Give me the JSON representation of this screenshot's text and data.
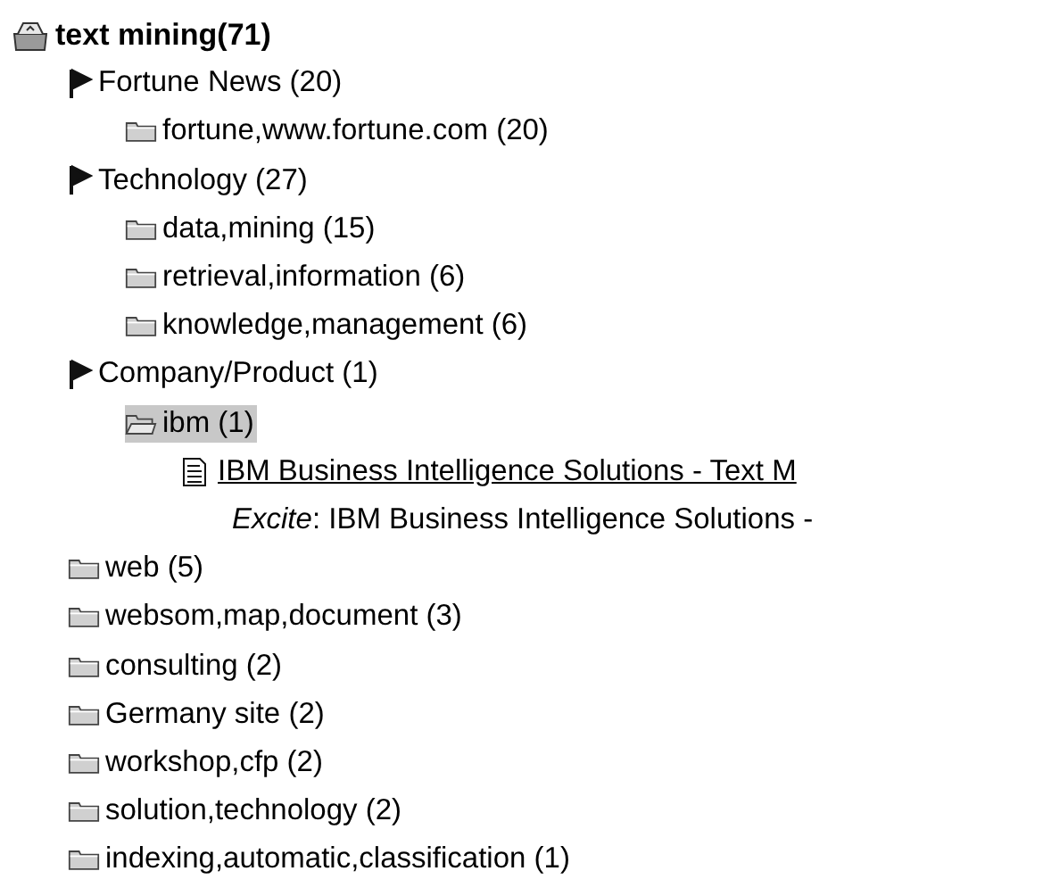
{
  "tree": {
    "kind": "root",
    "label": "text mining(71)",
    "children": [
      {
        "kind": "category",
        "label": "Fortune News (20)",
        "children": [
          {
            "kind": "folder",
            "label": "fortune,www.fortune.com (20)",
            "selected": false,
            "expanded": false
          }
        ]
      },
      {
        "kind": "category",
        "label": "Technology (27)",
        "children": [
          {
            "kind": "folder",
            "label": "data,mining (15)",
            "selected": false,
            "expanded": false
          },
          {
            "kind": "folder",
            "label": "retrieval,information (6)",
            "selected": false,
            "expanded": false
          },
          {
            "kind": "folder",
            "label": "knowledge,management (6)",
            "selected": false,
            "expanded": false
          }
        ]
      },
      {
        "kind": "category",
        "label": "Company/Product (1)",
        "children": [
          {
            "kind": "folder",
            "label": "ibm (1)",
            "selected": true,
            "expanded": true,
            "children": [
              {
                "kind": "document",
                "label": "IBM Business Intelligence Solutions - Text M",
                "children": [
                  {
                    "kind": "snippet",
                    "label": "*Excite*: IBM Business Intelligence Solutions -"
                  }
                ]
              }
            ]
          }
        ]
      },
      {
        "kind": "folder",
        "label": "web (5)",
        "selected": false,
        "expanded": false
      },
      {
        "kind": "folder",
        "label": "websom,map,document (3)",
        "selected": false,
        "expanded": false
      },
      {
        "kind": "folder",
        "label": "consulting (2)",
        "selected": false,
        "expanded": false
      },
      {
        "kind": "folder",
        "label": "Germany site (2)",
        "selected": false,
        "expanded": false
      },
      {
        "kind": "folder",
        "label": "workshop,cfp (2)",
        "selected": false,
        "expanded": false
      },
      {
        "kind": "folder",
        "label": "solution,technology (2)",
        "selected": false,
        "expanded": false
      },
      {
        "kind": "folder",
        "label": "indexing,automatic,classification (1)",
        "selected": false,
        "expanded": false
      }
    ]
  }
}
